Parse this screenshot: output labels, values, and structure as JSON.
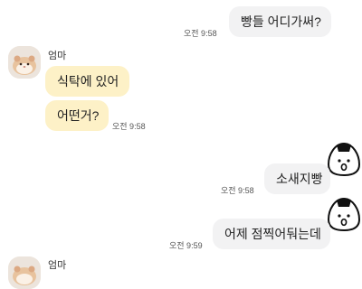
{
  "chat": {
    "messages": [
      {
        "side": "sent",
        "text": "빵들 어디가써?",
        "time": "오전 9:58"
      },
      {
        "sender": "엄마",
        "side": "recv",
        "text": "식탁에 있어"
      },
      {
        "side": "recv",
        "text": "어떤거?",
        "time": "오전 9:58"
      },
      {
        "side": "sent",
        "text": "소새지빵",
        "time": "오전 9:58"
      },
      {
        "side": "sent",
        "text": "어제 점찍어둬는데",
        "time": "오전 9:59"
      },
      {
        "sender": "엄마"
      }
    ]
  },
  "icons": {
    "avatar": "hamster-avatar",
    "sticker": "rice-ball-sticker"
  },
  "colors": {
    "background": "#ffffff",
    "sent_bubble": "#f2f2f3",
    "recv_bubble": "#fdf1c7",
    "text": "#222222",
    "timestamp": "#555555"
  }
}
